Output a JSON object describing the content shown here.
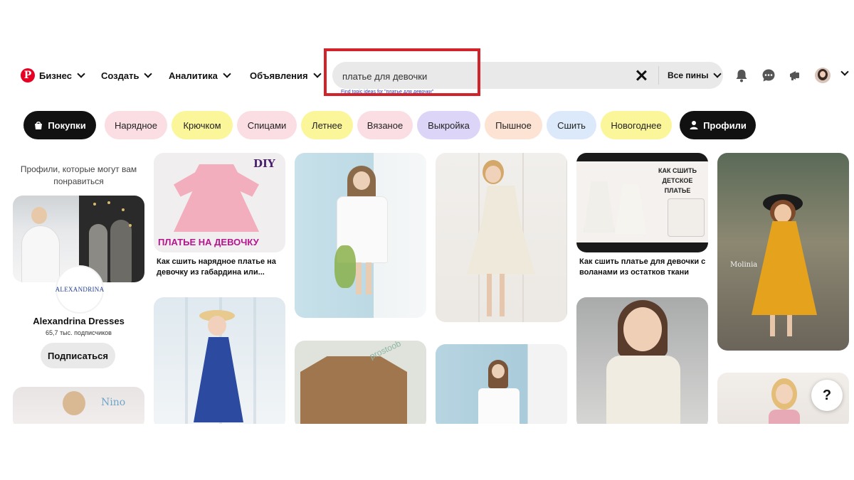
{
  "nav": {
    "logo_letter": "P",
    "business": "Бизнес",
    "create": "Создать",
    "analytics": "Аналитика",
    "ads": "Объявления"
  },
  "search": {
    "value": "платье для девочки",
    "hint": "Find topic ideas for \"платье для девочки\"",
    "filter_label": "Все пины"
  },
  "chips": [
    {
      "label": "Покупки",
      "bg": "#111111"
    },
    {
      "label": "Нарядное",
      "bg": "#fbdde4"
    },
    {
      "label": "Крючком",
      "bg": "#fbf69a"
    },
    {
      "label": "Спицами",
      "bg": "#fbdde4"
    },
    {
      "label": "Летнее",
      "bg": "#fbf69a"
    },
    {
      "label": "Вязаное",
      "bg": "#fbdde4"
    },
    {
      "label": "Выкройка",
      "bg": "#dcd5f7"
    },
    {
      "label": "Пышное",
      "bg": "#fde3d3"
    },
    {
      "label": "Сшить",
      "bg": "#dbe9fb"
    },
    {
      "label": "Новогоднее",
      "bg": "#fbf69a"
    },
    {
      "label": "Профили",
      "bg": "#111111"
    }
  ],
  "profile_card": {
    "title": "Профили, которые могут вам понравиться",
    "avatar_text": "ALEXANDRINA",
    "name": "Alexandrina Dresses",
    "subscribers": "65,7 тыс. подписчиков",
    "subscribe_button": "Подписаться"
  },
  "pins": {
    "pink_dress": {
      "overlay_top": "DIY",
      "overlay_bottom": "ПЛАТЬЕ НА ДЕВОЧКУ",
      "caption": "Как сшить нарядное платье на девочку из габардина или..."
    },
    "ruffle_dresses": {
      "overlay": "КАК СШИТЬ ДЕТСКОЕ ПЛАТЬЕ",
      "caption": "Как сшить платье для девочки с воланами из остатков ткани"
    },
    "yellow_dress": {
      "overlay": "Molinia"
    },
    "linen_dress": {
      "overlay": "prostoob"
    },
    "nino": {
      "overlay": "Nino"
    }
  },
  "help_label": "?"
}
